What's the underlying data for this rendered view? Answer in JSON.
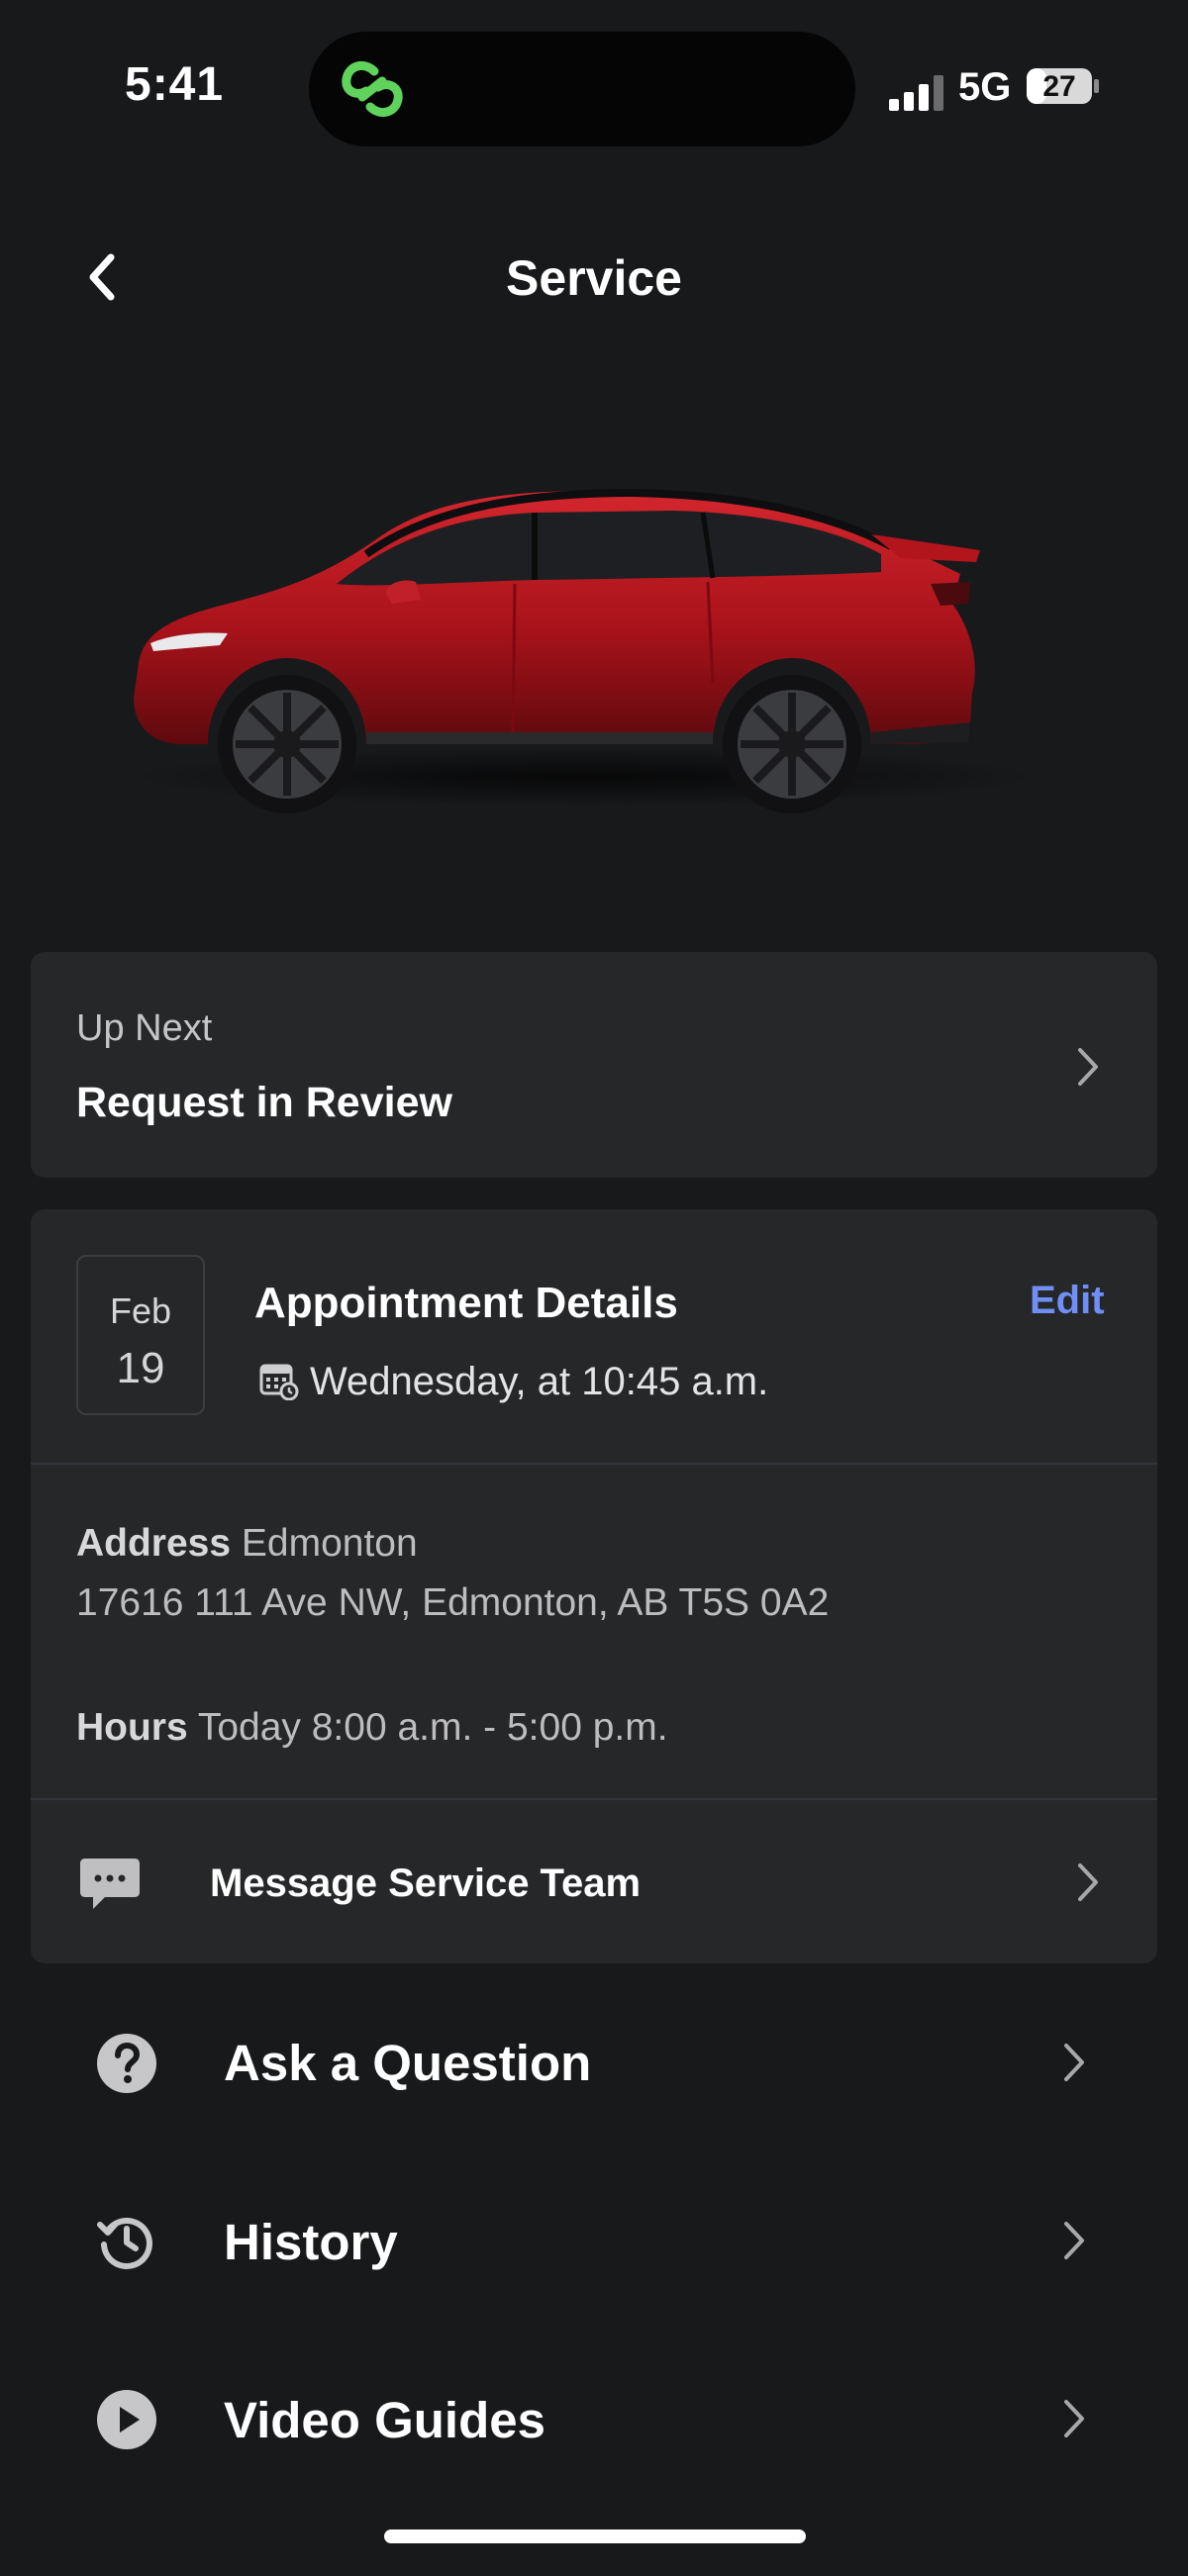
{
  "status_bar": {
    "time": "5:41",
    "network": "5G",
    "battery": "27"
  },
  "header": {
    "title": "Service"
  },
  "up_next": {
    "label": "Up Next",
    "value": "Request in Review"
  },
  "appointment": {
    "month": "Feb",
    "day": "19",
    "title": "Appointment Details",
    "edit_label": "Edit",
    "time_text": "Wednesday, at 10:45 a.m.",
    "address_label": "Address",
    "address_city": "Edmonton",
    "address_full": "17616 111 Ave NW, Edmonton, AB T5S 0A2",
    "hours_label": "Hours",
    "hours_value": "Today 8:00 a.m. - 5:00 p.m.",
    "message_label": "Message Service Team"
  },
  "menu": [
    {
      "label": "Ask a Question",
      "icon": "question-circle-icon"
    },
    {
      "label": "History",
      "icon": "history-icon"
    },
    {
      "label": "Video Guides",
      "icon": "play-circle-icon"
    }
  ],
  "colors": {
    "background": "#18191b",
    "card": "#262729",
    "accent": "#6f8ff5",
    "car": "#b0141c"
  }
}
